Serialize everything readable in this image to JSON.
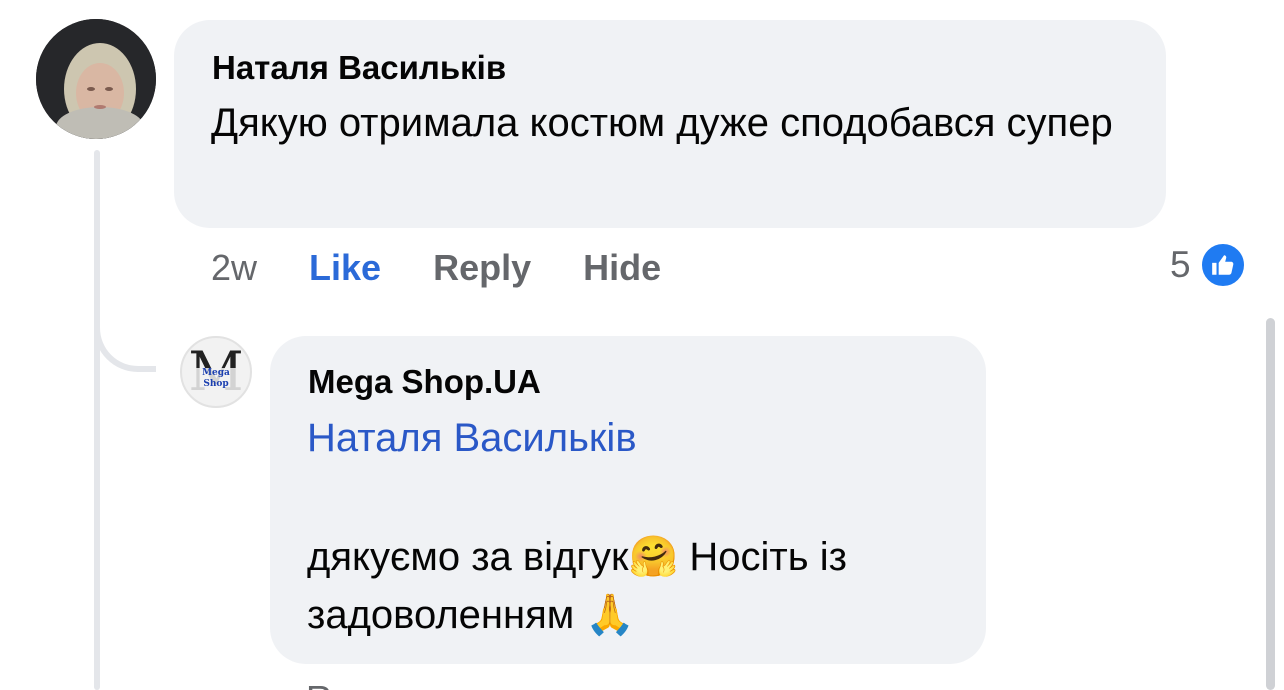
{
  "comment": {
    "author": "Наталя Васильків",
    "text": "Дякую отримала костюм дуже сподобався супер",
    "time": "2w",
    "actions": {
      "like": "Like",
      "reply": "Reply",
      "hide": "Hide"
    },
    "reaction_count": "5",
    "reaction_icon": "thumbs-up-icon"
  },
  "reply": {
    "author": "Mega Shop.UA",
    "avatar_letter": "M",
    "avatar_tag": "Mega Shop",
    "mention": "Наталя Васильків",
    "text_part1": "дякуємо за відгук",
    "emoji_hug": "🤗",
    "text_part2": " Носіть із задоволенням ",
    "emoji_pray": "🙏",
    "partial_next_line": "Re..."
  },
  "colors": {
    "bubble_bg": "#f0f2f5",
    "link_blue": "#2a58c7",
    "like_blue": "#2b6ad8",
    "badge_blue": "#1f7bf2",
    "muted": "#65676b"
  }
}
